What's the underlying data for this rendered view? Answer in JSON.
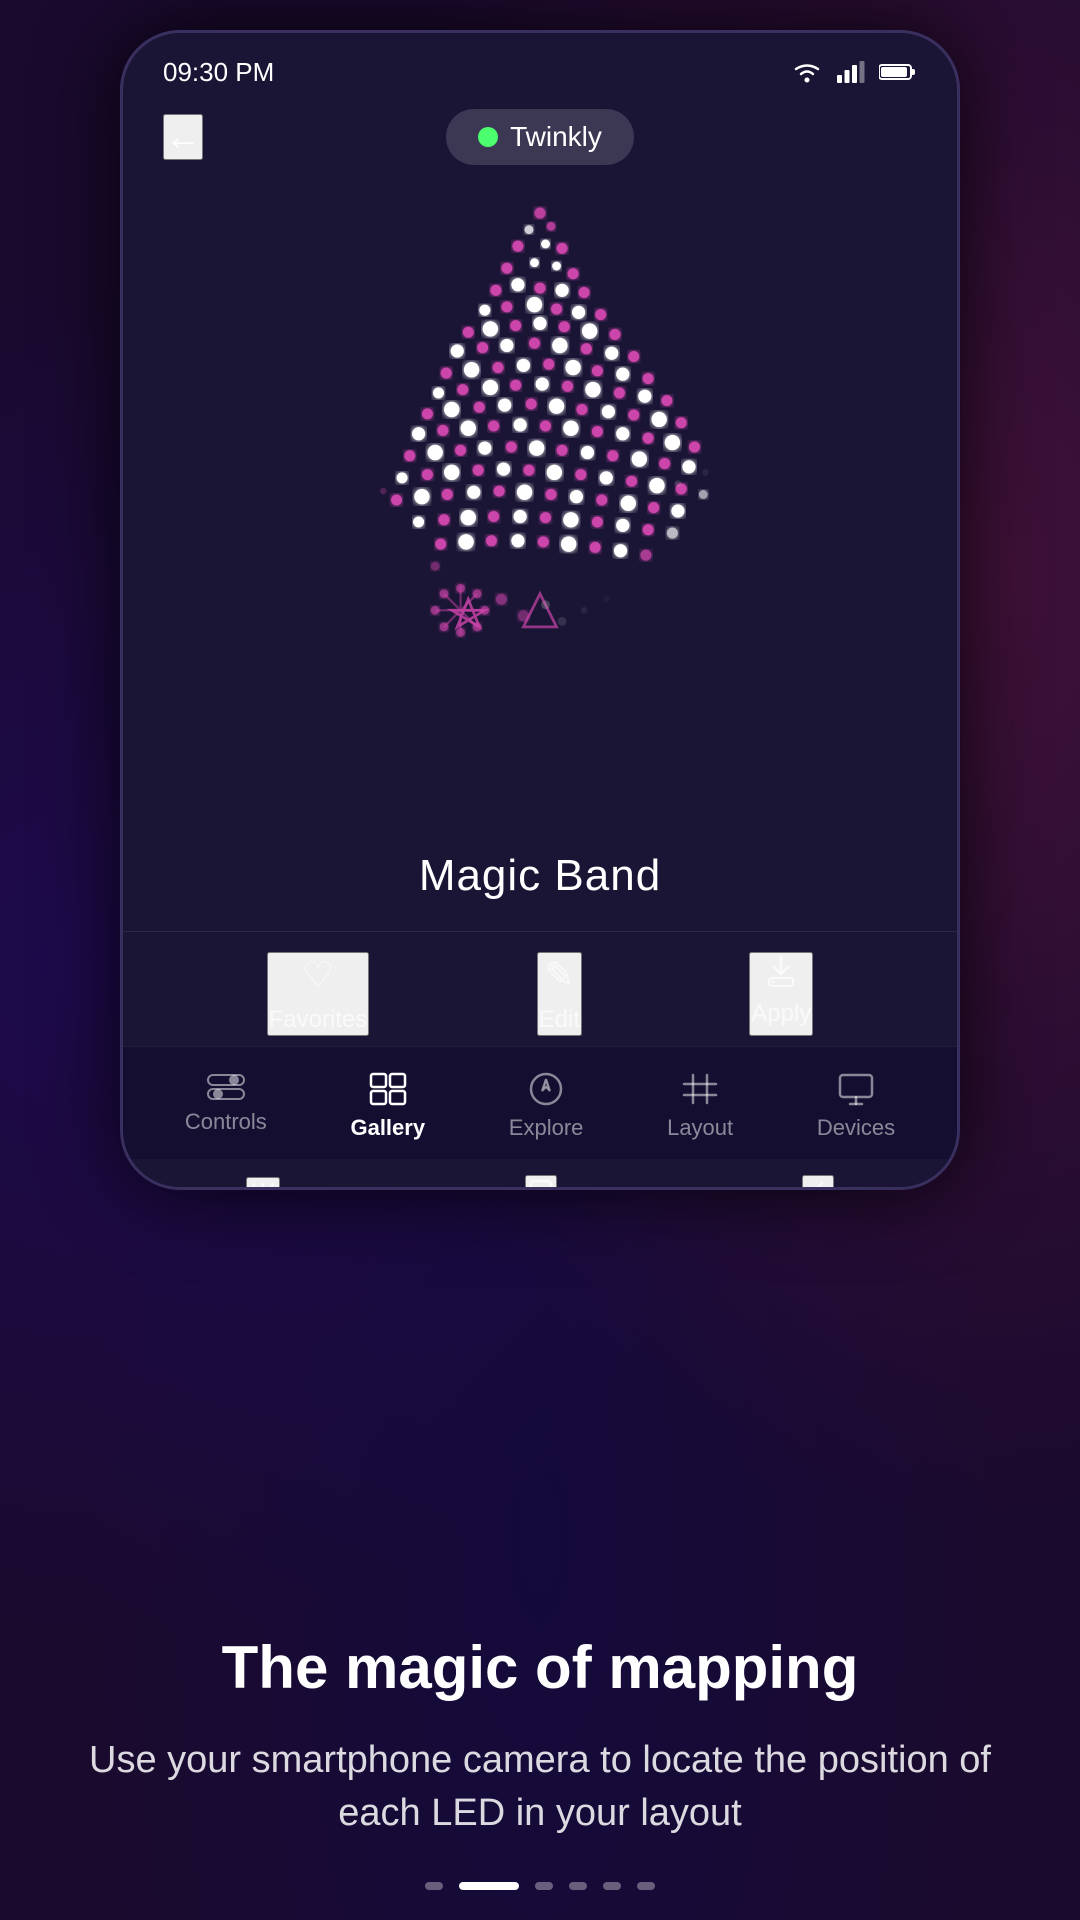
{
  "statusBar": {
    "time": "09:30 PM",
    "wifi": "wifi",
    "signal": "signal",
    "battery": "battery"
  },
  "topBar": {
    "backLabel": "←",
    "appName": "Twinkly"
  },
  "effectName": "Magic Band",
  "actionBar": {
    "favorites": {
      "icon": "♡",
      "label": "Favorites"
    },
    "edit": {
      "icon": "✎",
      "label": "Edit"
    },
    "apply": {
      "icon": "⬇",
      "label": "Apply"
    }
  },
  "bottomNav": {
    "items": [
      {
        "id": "controls",
        "label": "Controls",
        "active": false
      },
      {
        "id": "gallery",
        "label": "Gallery",
        "active": true
      },
      {
        "id": "explore",
        "label": "Explore",
        "active": false
      },
      {
        "id": "layout",
        "label": "Layout",
        "active": false
      },
      {
        "id": "devices",
        "label": "Devices",
        "active": false
      }
    ]
  },
  "androidNav": {
    "menu": "|||",
    "home": "○",
    "back": "‹"
  },
  "bottomSection": {
    "title": "The magic of mapping",
    "subtitle": "Use your smartphone camera to locate the position of each LED in your layout"
  },
  "pageIndicators": {
    "total": 6,
    "active": 1
  },
  "colors": {
    "accent": "#cc44aa",
    "white": "#ffffff",
    "bg": "#1a1535",
    "green": "#4cff6e"
  }
}
